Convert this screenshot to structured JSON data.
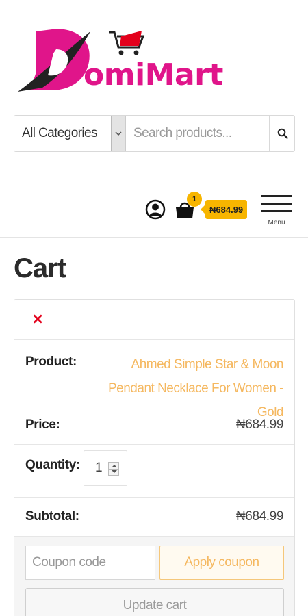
{
  "brand": {
    "logo_text": "omiMart",
    "logo_letter": "D"
  },
  "search": {
    "category_selected": "All Categories",
    "placeholder": "Search products..."
  },
  "header": {
    "cart_count": "1",
    "cart_total": "₦684.99",
    "menu_label": "Menu"
  },
  "page": {
    "title": "Cart"
  },
  "cart": {
    "remove_symbol": "×",
    "product_label": "Product:",
    "product_name": "Ahmed Simple Star & Moon Pendant Necklace For Women - Gold",
    "price_label": "Price:",
    "price_value": "₦684.99",
    "quantity_label": "Quantity:",
    "quantity_value": "1",
    "subtotal_label": "Subtotal:",
    "subtotal_value": "₦684.99"
  },
  "actions": {
    "coupon_placeholder": "Coupon code",
    "apply_label": "Apply coupon",
    "update_label": "Update cart"
  },
  "colors": {
    "brand_pink": "#e0158a",
    "accent_yellow": "#f7b500",
    "link_orange": "#f5b860",
    "remove_red": "#e3001b"
  }
}
